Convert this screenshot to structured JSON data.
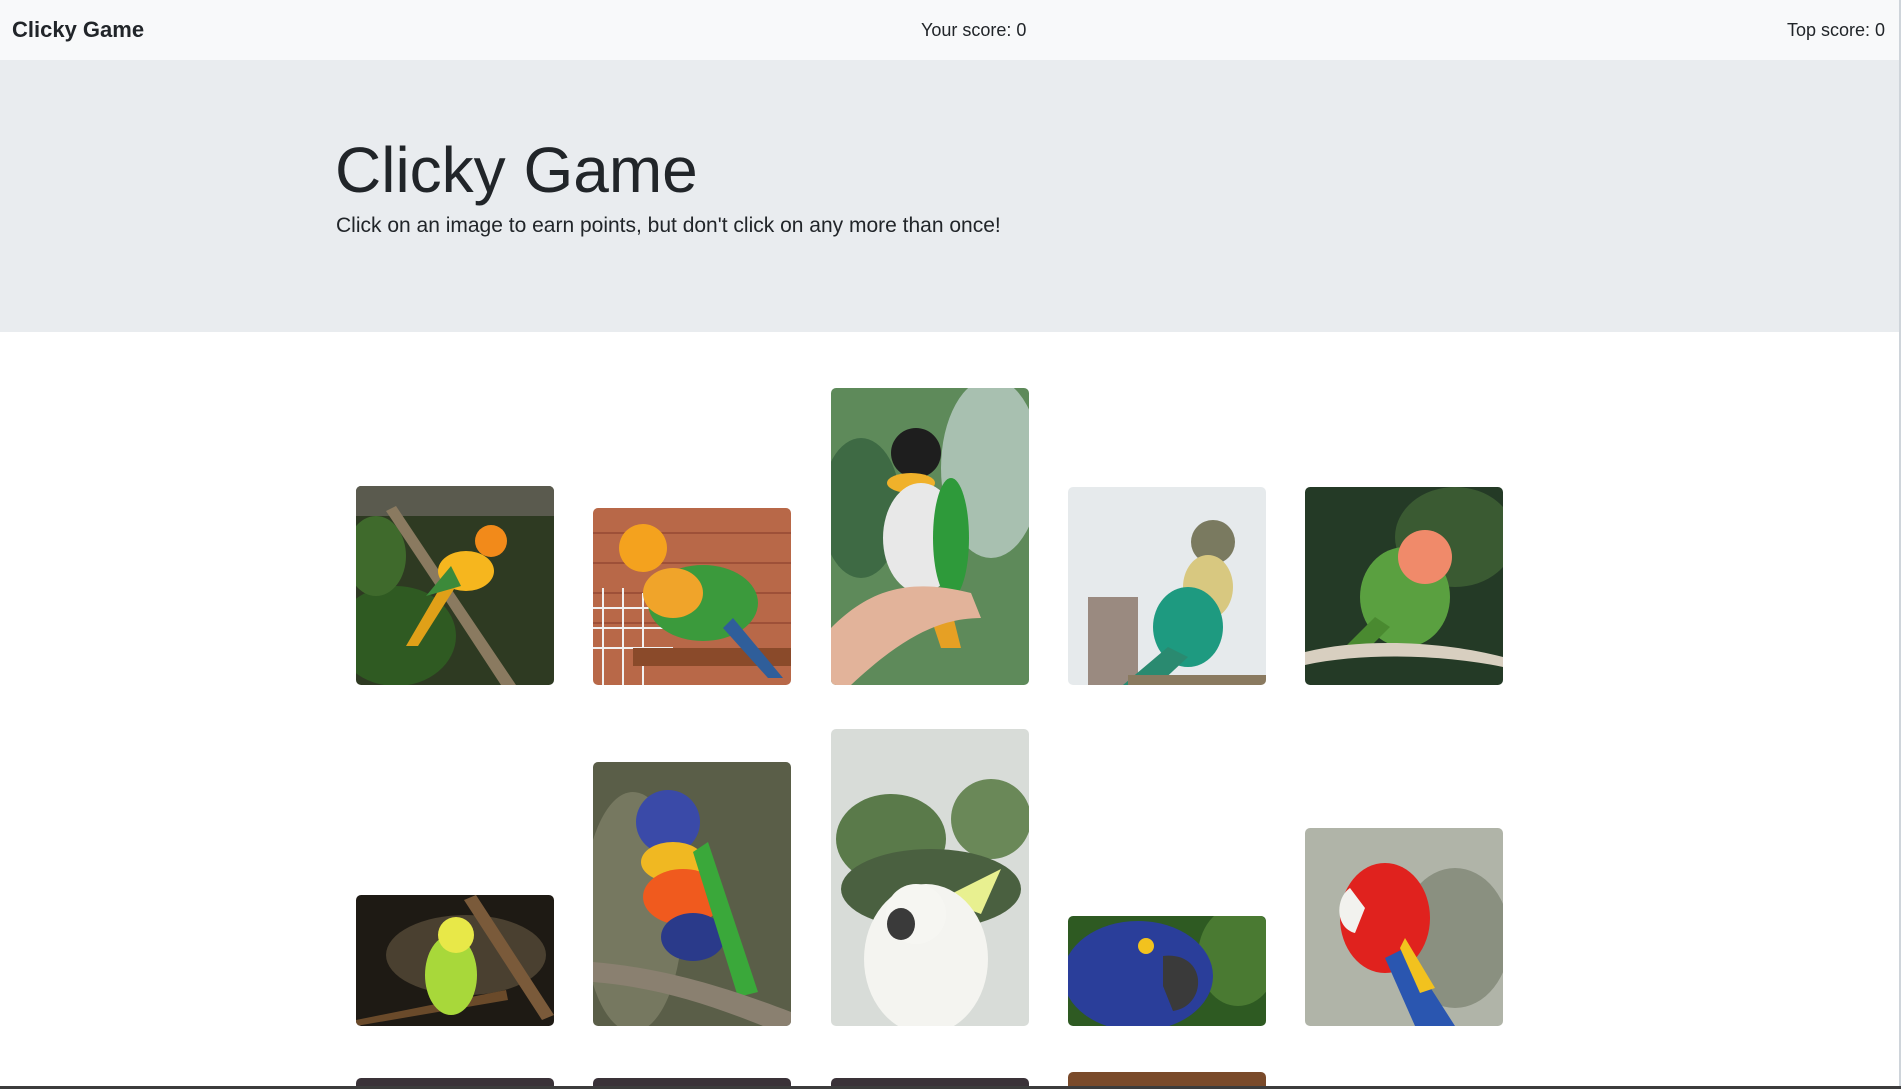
{
  "navbar": {
    "brand": "Clicky Game",
    "your_score_label": "Your score: 0",
    "top_score_label": "Top score: 0"
  },
  "jumbotron": {
    "title": "Clicky Game",
    "lead": "Click on an image to earn points, but don't click on any more than once!"
  },
  "colors": {
    "navbar_bg": "#f8f9fa",
    "jumbotron_bg": "#e9ecef",
    "text": "#212529"
  },
  "images": [
    {
      "subject": "sun conure"
    },
    {
      "subject": "jenday conure"
    },
    {
      "subject": "black-headed caique"
    },
    {
      "subject": "green-cheeked conure"
    },
    {
      "subject": "peach-faced lovebird"
    },
    {
      "subject": "budgerigar"
    },
    {
      "subject": "rainbow lorikeet"
    },
    {
      "subject": "sulphur-crested cockatoo"
    },
    {
      "subject": "hyacinth macaw"
    },
    {
      "subject": "scarlet macaw"
    },
    {
      "subject": "parrot"
    },
    {
      "subject": "parrot"
    },
    {
      "subject": "parrot"
    },
    {
      "subject": "parrot"
    }
  ]
}
